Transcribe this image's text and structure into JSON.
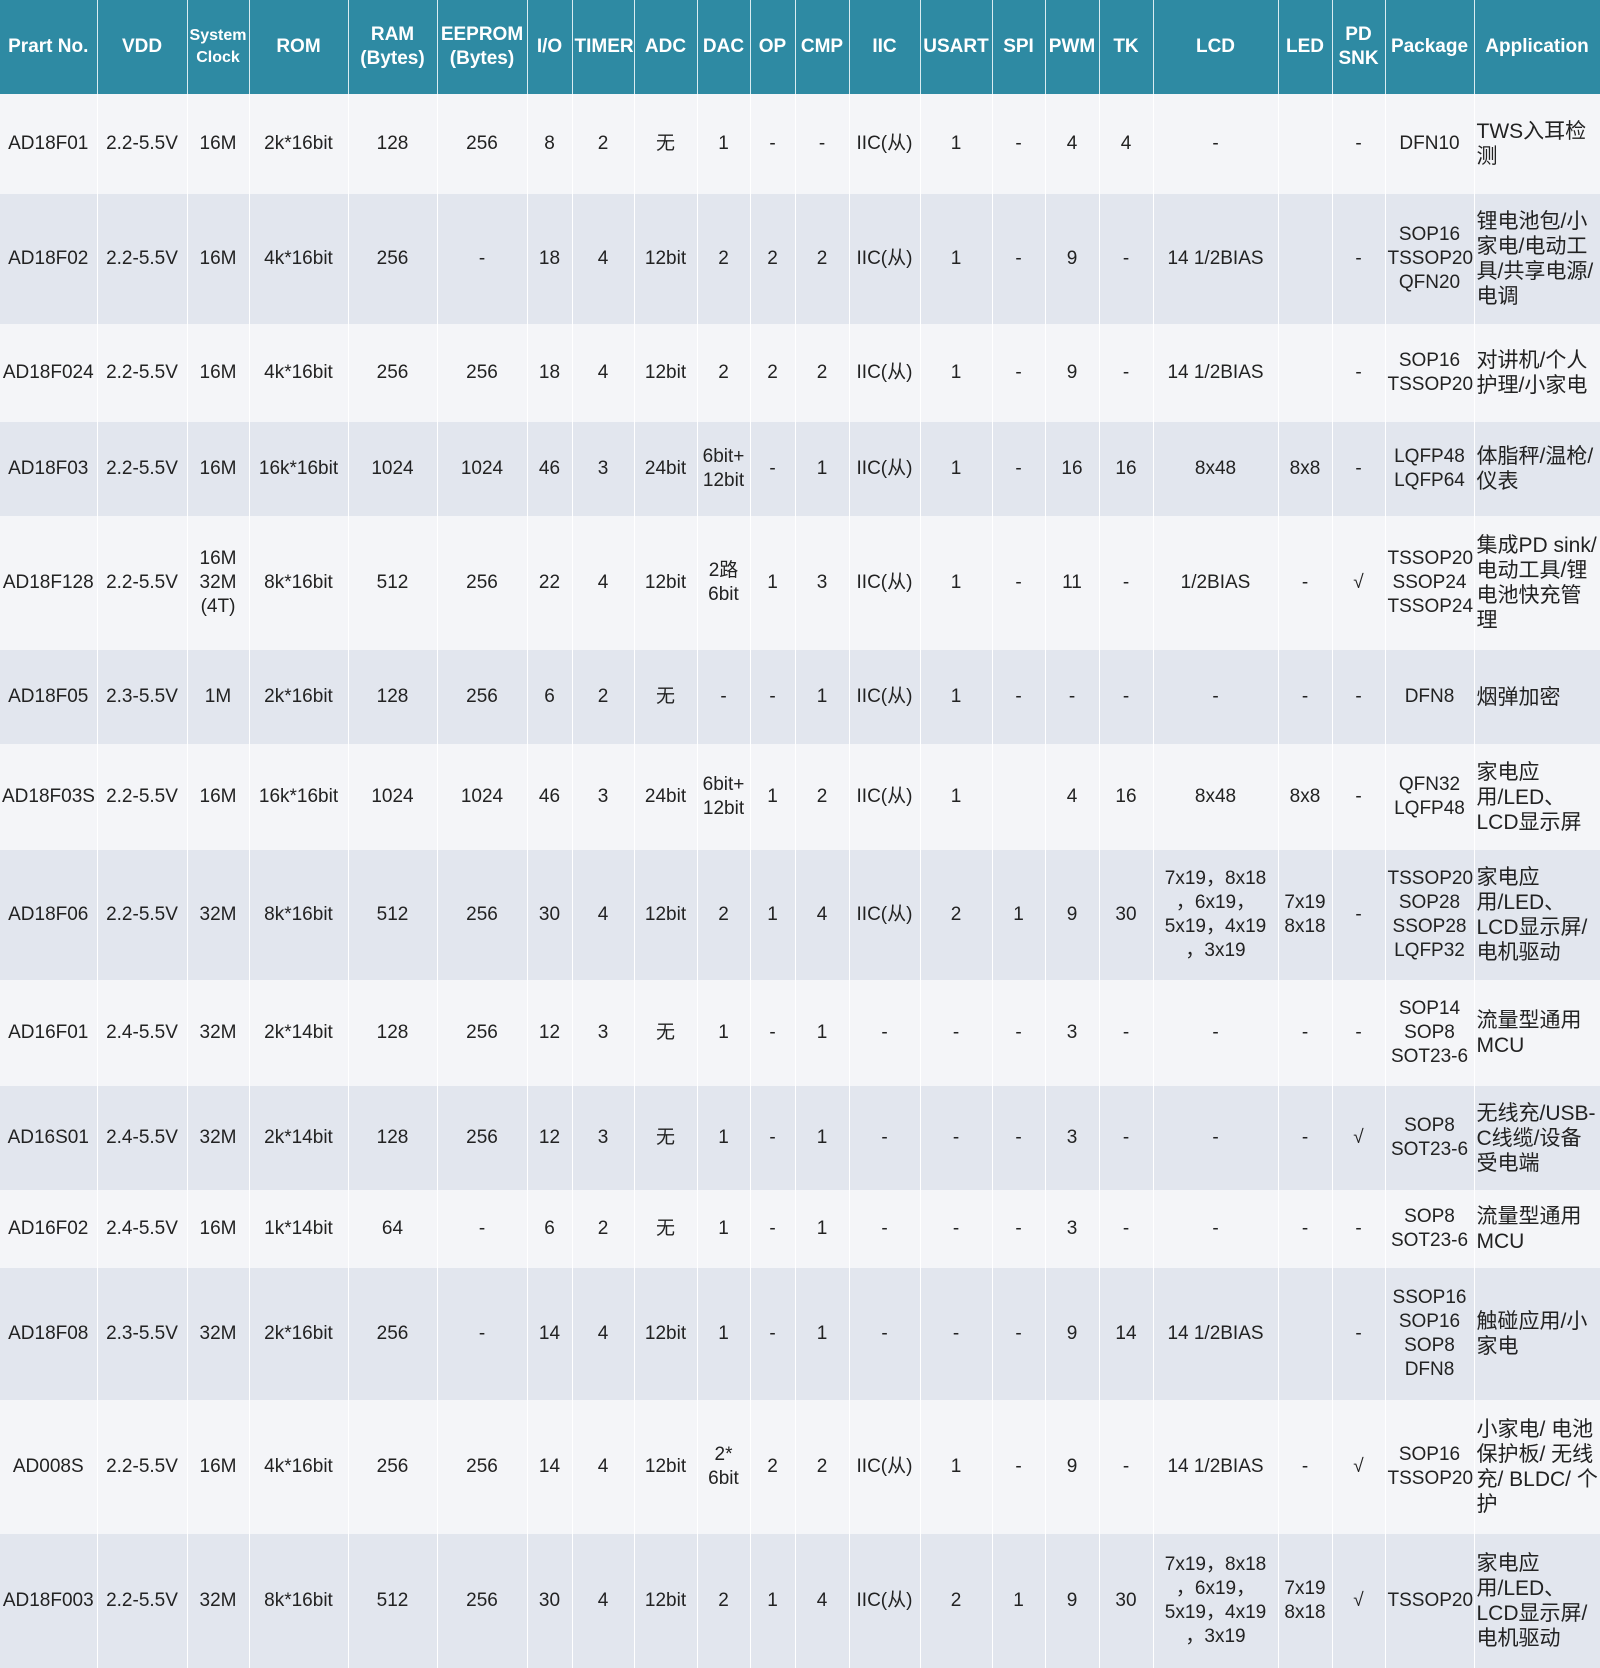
{
  "columns": [
    "Prart No.",
    "VDD",
    "System\nClock",
    "ROM",
    "RAM\n(Bytes)",
    "EEPROM\n(Bytes)",
    "I/O",
    "TIMER",
    "ADC",
    "DAC",
    "OP",
    "CMP",
    "IIC",
    "USART",
    "SPI",
    "PWM",
    "TK",
    "LCD",
    "LED",
    "PD\nSNK",
    "Package",
    "Application"
  ],
  "rows": [
    [
      "AD18F01",
      "2.2-5.5V",
      "16M",
      "2k*16bit",
      "128",
      "256",
      "8",
      "2",
      "无",
      "1",
      "-",
      "-",
      "IIC(从)",
      "1",
      "-",
      "4",
      "4",
      "-",
      "",
      "-",
      "DFN10",
      "TWS入耳检测"
    ],
    [
      "AD18F02",
      "2.2-5.5V",
      "16M",
      "4k*16bit",
      "256",
      "-",
      "18",
      "4",
      "12bit",
      "2",
      "2",
      "2",
      "IIC(从)",
      "1",
      "-",
      "9",
      "-",
      "14 1/2BIAS",
      "",
      "-",
      "SOP16\nTSSOP20\nQFN20",
      "锂电池包/小家电/电动工具/共享电源/电调"
    ],
    [
      "AD18F024",
      "2.2-5.5V",
      "16M",
      "4k*16bit",
      "256",
      "256",
      "18",
      "4",
      "12bit",
      "2",
      "2",
      "2",
      "IIC(从)",
      "1",
      "-",
      "9",
      "-",
      "14 1/2BIAS",
      "",
      "-",
      "SOP16\nTSSOP20",
      "对讲机/个人护理/小家电"
    ],
    [
      "AD18F03",
      "2.2-5.5V",
      "16M",
      "16k*16bit",
      "1024",
      "1024",
      "46",
      "3",
      "24bit",
      "6bit+\n12bit",
      "-",
      "1",
      "IIC(从)",
      "1",
      "-",
      "16",
      "16",
      "8x48",
      "8x8",
      "-",
      "LQFP48\nLQFP64",
      "体脂秤/温枪/仪表"
    ],
    [
      "AD18F128",
      "2.2-5.5V",
      "16M\n32M\n(4T)",
      "8k*16bit",
      "512",
      "256",
      "22",
      "4",
      "12bit",
      "2路\n6bit",
      "1",
      "3",
      "IIC(从)",
      "1",
      "-",
      "11",
      "-",
      "1/2BIAS",
      "-",
      "√",
      "TSSOP20\nSSOP24\nTSSOP24",
      "集成PD sink/电动工具/锂电池快充管理"
    ],
    [
      "AD18F05",
      "2.3-5.5V",
      "1M",
      "2k*16bit",
      "128",
      "256",
      "6",
      "2",
      "无",
      "-",
      "-",
      "1",
      "IIC(从)",
      "1",
      "-",
      "-",
      "-",
      "-",
      "-",
      "-",
      "DFN8",
      "烟弹加密"
    ],
    [
      "AD18F03S",
      "2.2-5.5V",
      "16M",
      "16k*16bit",
      "1024",
      "1024",
      "46",
      "3",
      "24bit",
      "6bit+\n12bit",
      "1",
      "2",
      "IIC(从)",
      "1",
      "",
      "4",
      "16",
      "8x48",
      "8x8",
      "-",
      "QFN32\nLQFP48",
      "家电应用/LED、LCD显示屏"
    ],
    [
      "AD18F06",
      "2.2-5.5V",
      "32M",
      "8k*16bit",
      "512",
      "256",
      "30",
      "4",
      "12bit",
      "2",
      "1",
      "4",
      "IIC(从)",
      "2",
      "1",
      "9",
      "30",
      "7x19，8x18\n，6x19，\n5x19，4x19\n，3x19",
      "7x19\n8x18",
      "-",
      "TSSOP20\nSOP28\nSSOP28\nLQFP32",
      "家电应用/LED、LCD显示屏/电机驱动"
    ],
    [
      "AD16F01",
      "2.4-5.5V",
      "32M",
      "2k*14bit",
      "128",
      "256",
      "12",
      "3",
      "无",
      "1",
      "-",
      "1",
      "-",
      "-",
      "-",
      "3",
      "-",
      "-",
      "-",
      "-",
      "SOP14\nSOP8\nSOT23-6",
      "流量型通用MCU"
    ],
    [
      "AD16S01",
      "2.4-5.5V",
      "32M",
      "2k*14bit",
      "128",
      "256",
      "12",
      "3",
      "无",
      "1",
      "-",
      "1",
      "-",
      "-",
      "-",
      "3",
      "-",
      "-",
      "-",
      "√",
      "SOP8\nSOT23-6",
      "无线充/USB-C线缆/设备受电端"
    ],
    [
      "AD16F02",
      "2.4-5.5V",
      "16M",
      "1k*14bit",
      "64",
      "-",
      "6",
      "2",
      "无",
      "1",
      "-",
      "1",
      "-",
      "-",
      "-",
      "3",
      "-",
      "-",
      "-",
      "-",
      "SOP8\nSOT23-6",
      "流量型通用MCU"
    ],
    [
      "AD18F08",
      "2.3-5.5V",
      "32M",
      "2k*16bit",
      "256",
      "-",
      "14",
      "4",
      "12bit",
      "1",
      "-",
      "1",
      "-",
      "-",
      "-",
      "9",
      "14",
      "14 1/2BIAS",
      "",
      "-",
      "SSOP16\nSOP16\nSOP8\nDFN8",
      "触碰应用/小家电"
    ],
    [
      "AD008S",
      "2.2-5.5V",
      "16M",
      "4k*16bit",
      "256",
      "256",
      "14",
      "4",
      "12bit",
      "2*\n6bit",
      "2",
      "2",
      "IIC(从)",
      "1",
      "-",
      "9",
      "-",
      "14 1/2BIAS",
      "-",
      "√",
      "SOP16\nTSSOP20",
      "小家电/ 电池保护板/ 无线充/ BLDC/ 个护"
    ],
    [
      "AD18F003",
      "2.2-5.5V",
      "32M",
      "8k*16bit",
      "512",
      "256",
      "30",
      "4",
      "12bit",
      "2",
      "1",
      "4",
      "IIC(从)",
      "2",
      "1",
      "9",
      "30",
      "7x19，8x18\n，6x19，\n5x19，4x19\n，3x19",
      "7x19\n8x18",
      "√",
      "TSSOP20",
      "家电应用/LED、LCD显示屏/电机驱动"
    ]
  ]
}
